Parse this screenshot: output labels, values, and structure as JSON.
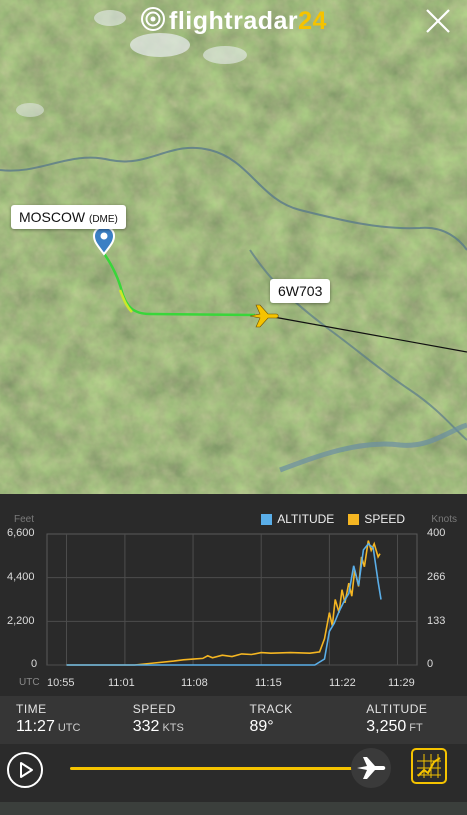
{
  "app": {
    "brand_main": "flightradar",
    "brand_num": "24"
  },
  "map": {
    "origin_city": "MOSCOW",
    "origin_code": "(DME)",
    "flight_label": "6W703"
  },
  "chart_data": {
    "type": "line",
    "left_axis_label": "Feet",
    "right_axis_label": "Knots",
    "legend": [
      "ALTITUDE",
      "SPEED"
    ],
    "colors": {
      "altitude": "#5aaee8",
      "speed": "#f5b622"
    },
    "y_left_ticks": [
      "6,600",
      "4,400",
      "2,200",
      "0"
    ],
    "y_right_ticks": [
      "400",
      "266",
      "133",
      "0"
    ],
    "x_ticks": [
      "UTC",
      "10:55",
      "11:01",
      "11:08",
      "11:15",
      "11:22",
      "11:29"
    ],
    "x_tick_minutes": [
      55,
      61,
      68,
      75,
      82,
      89
    ],
    "ylim_left": [
      0,
      6600
    ],
    "ylim_right": [
      0,
      400
    ],
    "series": [
      {
        "name": "ALTITUDE",
        "axis": "left",
        "x": [
          55,
          80.5,
          81.5,
          82.0,
          82.5,
          83.0,
          83.5,
          84.0,
          84.5,
          85.0,
          85.5,
          86.0,
          86.5,
          87.0,
          87.3
        ],
        "y": [
          0,
          0,
          300,
          1700,
          2100,
          2700,
          3200,
          3600,
          5000,
          4000,
          5800,
          6100,
          5900,
          4200,
          3300
        ]
      },
      {
        "name": "SPEED",
        "axis": "right",
        "x": [
          55,
          62,
          64,
          66,
          67,
          68,
          69,
          69.5,
          70,
          71,
          72,
          73,
          74,
          75,
          76,
          78,
          80,
          81,
          81.5,
          82,
          82.3,
          82.6,
          83,
          83.3,
          83.6,
          84,
          84.3,
          84.6,
          85,
          85.3,
          85.6,
          86,
          86.3,
          86.6,
          87,
          87.2
        ],
        "y": [
          0,
          0,
          6,
          12,
          16,
          18,
          20,
          28,
          22,
          30,
          26,
          34,
          32,
          38,
          36,
          38,
          36,
          40,
          80,
          160,
          120,
          200,
          160,
          230,
          190,
          250,
          210,
          290,
          240,
          330,
          300,
          380,
          350,
          370,
          330,
          340
        ]
      }
    ]
  },
  "stats": [
    {
      "title": "TIME",
      "value": "11:27",
      "unit": "UTC"
    },
    {
      "title": "SPEED",
      "value": "332",
      "unit": "KTS"
    },
    {
      "title": "TRACK",
      "value": "89°",
      "unit": ""
    },
    {
      "title": "ALTITUDE",
      "value": "3,250",
      "unit": "FT"
    }
  ],
  "player": {
    "progress": 0.94
  }
}
